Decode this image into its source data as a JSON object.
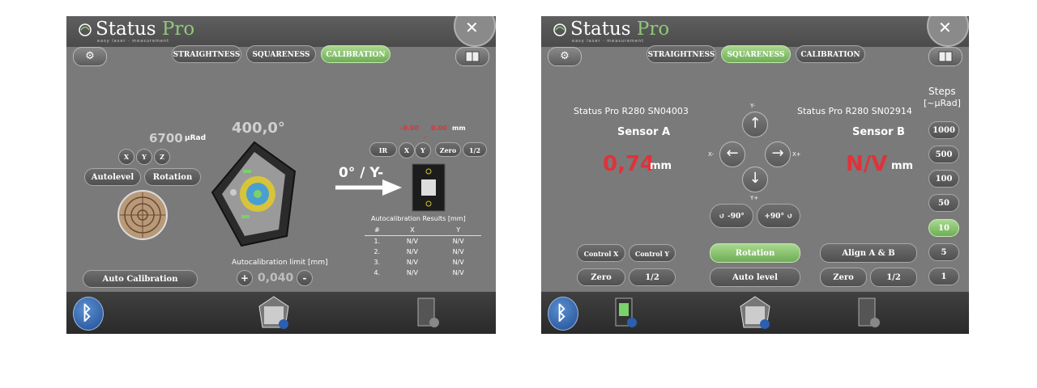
{
  "brand": {
    "name": "Status",
    "pro": "Pro",
    "tagline": "easy laser · measurement"
  },
  "close_glyph": "✕",
  "left": {
    "tabs": [
      {
        "label": "STRAIGHTNESS",
        "active": false
      },
      {
        "label": "SQUARENESS",
        "active": false
      },
      {
        "label": "CALIBRATION",
        "active": true
      }
    ],
    "angle": "400,0°",
    "urad_value": "6700",
    "urad_unit": "µRad",
    "axis_buttons": [
      "X",
      "Y",
      "Z"
    ],
    "autolevel_label": "Autolevel",
    "rotation_label": "Rotation",
    "auto_calibration_label": "Auto Calibration",
    "limit_label": "Autocalibration limit [mm]",
    "limit_value": "0,040",
    "plus": "+",
    "minus": "-",
    "position_label": "0° / Y-",
    "readout_x": "-0.00",
    "readout_y": "0.00",
    "readout_unit": "mm",
    "sensor_buttons": [
      "IR",
      "X",
      "Y",
      "Zero",
      "1/2"
    ],
    "results_title": "Autocalibration Results [mm]",
    "results_headers": [
      "#",
      "X",
      "Y"
    ],
    "results_rows": [
      [
        "1.",
        "N/V",
        "N/V"
      ],
      [
        "2.",
        "N/V",
        "N/V"
      ],
      [
        "3.",
        "N/V",
        "N/V"
      ],
      [
        "4.",
        "N/V",
        "N/V"
      ]
    ]
  },
  "right": {
    "tabs": [
      {
        "label": "STRAIGHTNESS",
        "active": false
      },
      {
        "label": "SQUARENESS",
        "active": true
      },
      {
        "label": "CALIBRATION",
        "active": false
      }
    ],
    "sensor_a_id": "Status Pro R280 SN04003",
    "sensor_a_label": "Sensor A",
    "sensor_a_value": "0,74",
    "sensor_b_id": "Status Pro R280 SN02914",
    "sensor_b_label": "Sensor B",
    "sensor_b_value": "N/V",
    "unit": "mm",
    "steps_title": "Steps",
    "steps_unit": "[~µRad]",
    "steps": [
      {
        "label": "1000",
        "active": false
      },
      {
        "label": "500",
        "active": false
      },
      {
        "label": "100",
        "active": false
      },
      {
        "label": "50",
        "active": false
      },
      {
        "label": "10",
        "active": true
      },
      {
        "label": "5",
        "active": false
      },
      {
        "label": "1",
        "active": false
      }
    ],
    "axis_labels": {
      "y_minus": "Y-",
      "x_minus": "X-",
      "x_plus": "X+",
      "y_plus": "Y+"
    },
    "rot_minus": "↺ -90°",
    "rot_plus": "+90° ↺",
    "control_x": "Control X",
    "control_y": "Control Y",
    "zero": "Zero",
    "half": "1/2",
    "rotation": "Rotation",
    "auto_level": "Auto level",
    "align": "Align A & B",
    "zero_b": "Zero",
    "half_b": "1/2"
  },
  "colors": {
    "accent_green": "#7fc064",
    "value_red": "#e0323a",
    "panel_gray": "#7a7a7a"
  }
}
